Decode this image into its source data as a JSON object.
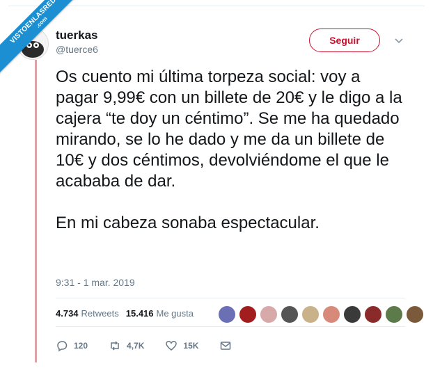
{
  "watermark": {
    "line1": "VISTOENLASREDES",
    "line2": ".com"
  },
  "author": {
    "name": "tuerkas",
    "handle": "@tuerce6"
  },
  "follow_label": "Seguir",
  "tweet": {
    "paragraph1": "Os cuento mi última torpeza social: voy a pagar 9,99€ con un billete de 20€ y le digo a la cajera “te doy un céntimo”. Se me ha quedado mirando, se lo he dado y me da un billete de 10€ y dos céntimos, devolviéndome el que le acababa de dar.",
    "paragraph2": "En mi cabeza sonaba espectacular.",
    "timestamp": "9:31 - 1 mar. 2019"
  },
  "stats": {
    "retweets_count": "4.734",
    "retweets_label": "Retweets",
    "likes_count": "15.416",
    "likes_label": "Me gusta"
  },
  "liker_avatar_colors": [
    "#6b6fb4",
    "#a21d1d",
    "#d8a9a9",
    "#555555",
    "#c9b28a",
    "#d88a7a",
    "#3a3a3a",
    "#8a2a2a",
    "#5c7a4a",
    "#7a5a3a"
  ],
  "actions": {
    "replies": "120",
    "retweets": "4,7K",
    "likes": "15K"
  },
  "colors": {
    "accent": "#c8102e",
    "muted": "#657786",
    "ribbon": "#1b8fd1"
  }
}
